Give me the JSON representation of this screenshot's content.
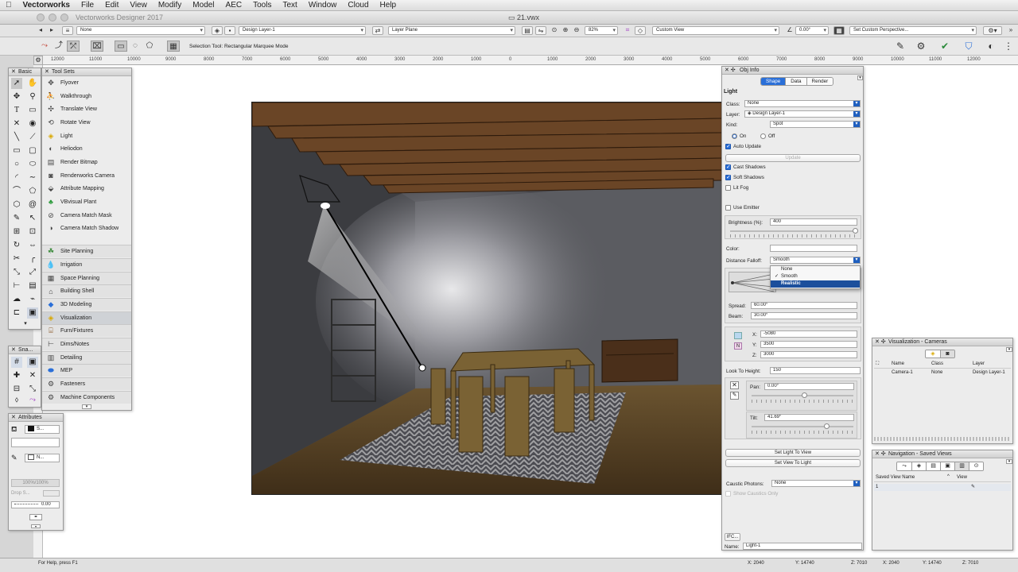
{
  "menubar": {
    "apple": "",
    "app": "Vectorworks",
    "items": [
      "File",
      "Edit",
      "View",
      "Modify",
      "Model",
      "AEC",
      "Tools",
      "Text",
      "Window",
      "Cloud",
      "Help"
    ]
  },
  "window": {
    "app_title": "Vectorworks Designer 2017",
    "doc_title": "21.vwx"
  },
  "viewbar": {
    "class": "None",
    "layer": "Design Layer-1",
    "plane": "Layer Plane",
    "zoom": "82%",
    "view": "Custom View",
    "angle": "0.00°",
    "render": "Set Custom Perspective..."
  },
  "modebar": {
    "hint": "Selection Tool: Rectangular Marquee Mode"
  },
  "ruler": [
    "12000",
    "11000",
    "10000",
    "9000",
    "8000",
    "7000",
    "6000",
    "5000",
    "4000",
    "3000",
    "2000",
    "1000",
    "0",
    "1000",
    "2000",
    "3000",
    "4000",
    "5000",
    "6000",
    "7000",
    "8000",
    "9000",
    "10000",
    "11000",
    "12000"
  ],
  "basic": {
    "title": "Basic",
    "snap_title": "Sna..."
  },
  "toolsets": {
    "title": "Tool Sets",
    "tools": [
      {
        "icon": "flyover-icon",
        "label": "Flyover"
      },
      {
        "icon": "walkthrough-icon",
        "label": "Walkthrough"
      },
      {
        "icon": "translate-view-icon",
        "label": "Translate View"
      },
      {
        "icon": "rotate-view-icon",
        "label": "Rotate View"
      },
      {
        "icon": "light-icon",
        "label": "Light"
      },
      {
        "icon": "heliodon-icon",
        "label": "Heliodon"
      },
      {
        "icon": "render-bitmap-icon",
        "label": "Render Bitmap"
      },
      {
        "icon": "renderworks-camera-icon",
        "label": "Renderworks Camera"
      },
      {
        "icon": "attribute-mapping-icon",
        "label": "Attribute Mapping"
      },
      {
        "icon": "vbvisual-plant-icon",
        "label": "VBvisual Plant"
      },
      {
        "icon": "camera-match-mask-icon",
        "label": "Camera Match Mask"
      },
      {
        "icon": "camera-match-shadow-icon",
        "label": "Camera Match Shadow"
      }
    ],
    "categories": [
      "Site Planning",
      "Irrigation",
      "Space Planning",
      "Building Shell",
      "3D Modeling",
      "Visualization",
      "Furn/Fixtures",
      "Dims/Notes",
      "Detailing",
      "MEP",
      "Fasteners",
      "Machine Components"
    ],
    "selected": "Visualization"
  },
  "attributes": {
    "title": "Attributes",
    "fill": "S...",
    "pen": "N...",
    "opacity": "100%/100%",
    "drop_shadow": "Drop S...",
    "line_weight": "0.00"
  },
  "objinfo": {
    "title": "Obj Info",
    "tabs": [
      "Shape",
      "Data",
      "Render"
    ],
    "object": "Light",
    "class_label": "Class:",
    "class_value": "None",
    "layer_label": "Layer:",
    "layer_value": "Design Layer-1",
    "kind_label": "Kind:",
    "kind_value": "Spot",
    "on_label": "On",
    "off_label": "Off",
    "auto_update": "Auto Update",
    "update_btn": "Update",
    "cast_shadows": "Cast Shadows",
    "soft_shadows": "Soft Shadows",
    "lit_fog": "Lit Fog",
    "use_emitter": "Use Emitter",
    "brightness_label": "Brightness (%):",
    "brightness_value": "400",
    "color_label": "Color:",
    "falloff_label": "Distance Falloff:",
    "falloff_value": "Smooth",
    "falloff_options": [
      "None",
      "Smooth",
      "Realistic"
    ],
    "falloff_checked": "Smooth",
    "falloff_highlight": "Realistic",
    "spread_label": "Spread:",
    "spread_value": "60.00°",
    "beam_label": "Beam:",
    "beam_value": "30.00°",
    "x_label": "X:",
    "x_value": "-5080",
    "y_label": "Y:",
    "y_value": "3500",
    "z_label": "Z:",
    "z_value": "3000",
    "look_label": "Look To Height:",
    "look_value": "150",
    "pan_label": "Pan:",
    "pan_value": "0.00°",
    "tilt_label": "Tilt:",
    "tilt_value": "41.69°",
    "set_light_btn": "Set Light To View",
    "set_view_btn": "Set View To Light",
    "caustic_label": "Caustic Photons:",
    "caustic_value": "None",
    "show_caustics": "Show Caustics Only",
    "ifc": "IFC...",
    "name_label": "Name:",
    "name_value": "Light-1"
  },
  "cameras": {
    "title": "Visualization - Cameras",
    "headers": [
      "Name",
      "Class",
      "Layer"
    ],
    "rows": [
      {
        "name": "Camera-1",
        "class": "None",
        "layer": "Design Layer-1"
      }
    ]
  },
  "savedviews": {
    "title": "Navigation - Saved Views",
    "headers": [
      "Saved View Name",
      "View"
    ],
    "rows": [
      {
        "name": "1",
        "view": ""
      }
    ]
  },
  "status": {
    "help": "For Help, press F1",
    "x1": "X: 2040",
    "y1": "Y: 14740",
    "z1": "Z: 7010",
    "x2": "X: 2040",
    "y2": "Y: 14740",
    "z2": "Z: 7010"
  },
  "colors": {
    "accent": "#1f5fbf",
    "selection": "#1c4f9c"
  }
}
